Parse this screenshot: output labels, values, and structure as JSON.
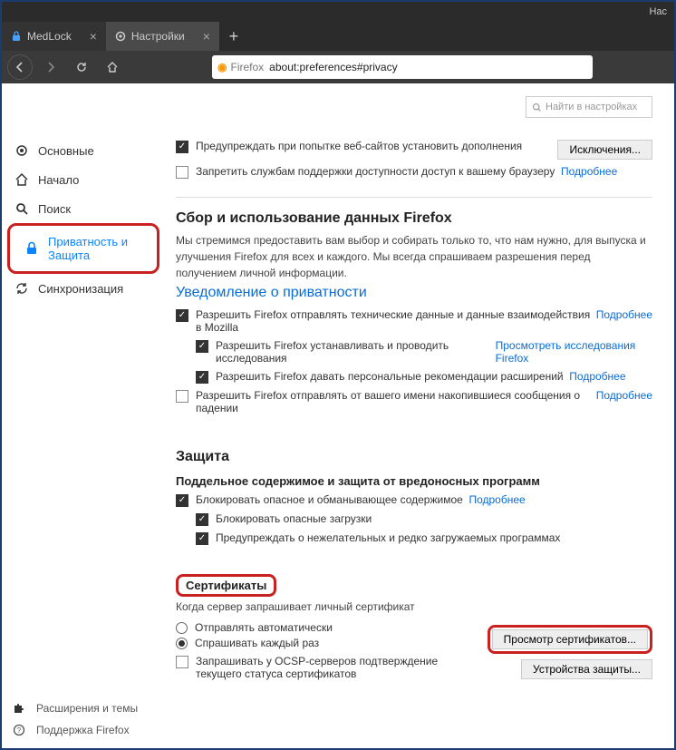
{
  "titlebar": {
    "text": "Нас"
  },
  "tabs": {
    "t1": {
      "label": "MedLock"
    },
    "t2": {
      "label": "Настройки"
    }
  },
  "urlbar": {
    "ffname": "Firefox",
    "addr": "about:preferences#privacy"
  },
  "search": {
    "placeholder": "Найти в настройках"
  },
  "sidebar": {
    "general": "Основные",
    "home": "Начало",
    "search": "Поиск",
    "privacy": "Приватность и Защита",
    "sync": "Синхронизация",
    "ext": "Расширения и темы",
    "support": "Поддержка Firefox"
  },
  "top": {
    "warn_addons": "Предупреждать при попытке веб-сайтов установить дополнения",
    "exceptions_btn": "Исключения...",
    "block_a11y": "Запретить службам поддержки доступности доступ к вашему браузеру",
    "more": "Подробнее"
  },
  "datacoll": {
    "title": "Сбор и использование данных Firefox",
    "desc": "Мы стремимся предоставить вам выбор и собирать только то, что нам нужно, для выпуска и улучшения Firefox для всех и каждого. Мы всегда спрашиваем разрешения перед получением личной информации.",
    "privacy_notice": "Уведомление о приватности",
    "tech": "Разрешить Firefox отправлять технические данные и данные взаимодействия в Mozilla",
    "studies": "Разрешить Firefox устанавливать и проводить исследования",
    "studies_link": "Просмотреть исследования Firefox",
    "recs": "Разрешить Firefox давать персональные рекомендации расширений",
    "crash": "Разрешить Firefox отправлять от вашего имени накопившиеся сообщения о падении",
    "more": "Подробнее"
  },
  "security": {
    "title": "Защита",
    "sub": "Поддельное содержимое и защита от вредоносных программ",
    "block_danger": "Блокировать опасное и обманывающее содержимое",
    "block_dl": "Блокировать опасные загрузки",
    "warn_dl": "Предупреждать о нежелательных и редко загружаемых программах",
    "more": "Подробнее"
  },
  "cert": {
    "title": "Сертификаты",
    "desc": "Когда сервер запрашивает личный сертификат",
    "auto": "Отправлять автоматически",
    "ask": "Спрашивать каждый раз",
    "ocsp": "Запрашивать у OCSP-серверов подтверждение текущего статуса сертификатов",
    "view_btn": "Просмотр сертификатов...",
    "devices_btn": "Устройства защиты..."
  }
}
